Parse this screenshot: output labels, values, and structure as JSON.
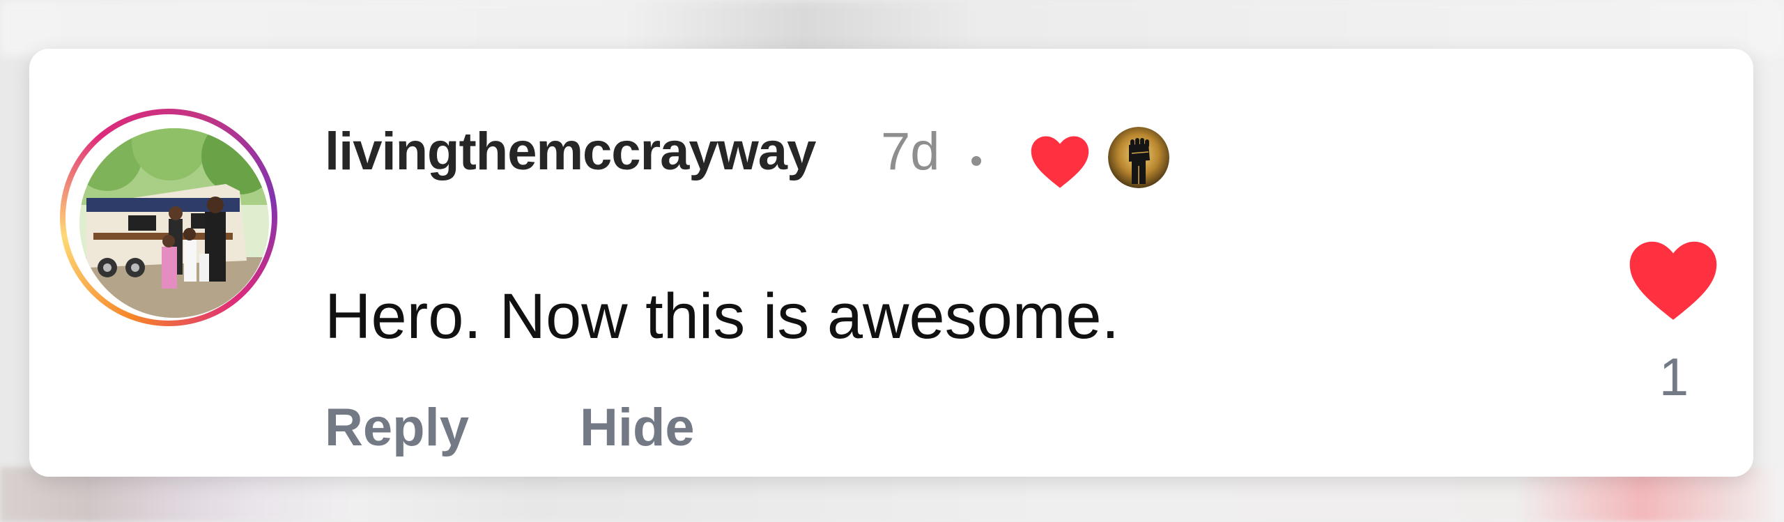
{
  "comment": {
    "username": "livingthemccrayway",
    "time_ago": "7d",
    "separator": "•",
    "text": "Hero. Now this is awesome.",
    "creator_liked": true
  },
  "actions": {
    "reply_label": "Reply",
    "hide_label": "Hide"
  },
  "likes": {
    "count": "1",
    "liked": true
  },
  "icons": {
    "creator_heart": "heart-icon",
    "like": "heart-icon",
    "creator_avatar": "fist-logo-icon"
  },
  "colors": {
    "heart": "#ff3040",
    "username": "#262626",
    "muted": "#8e8e8e",
    "action": "#737a85",
    "text": "#111111"
  }
}
